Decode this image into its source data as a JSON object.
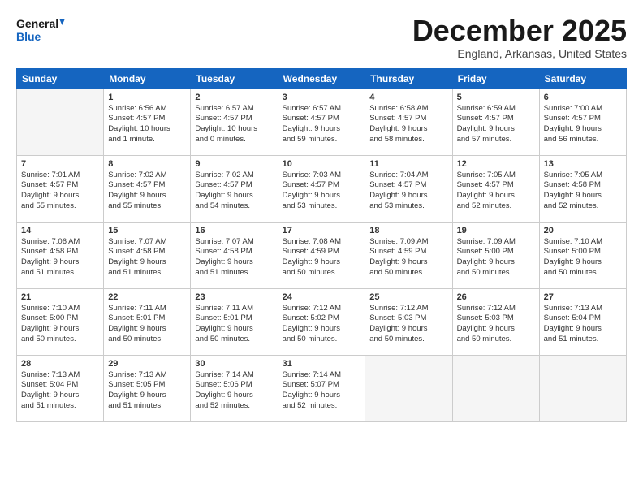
{
  "logo": {
    "line1": "General",
    "line2": "Blue"
  },
  "title": "December 2025",
  "subtitle": "England, Arkansas, United States",
  "days_header": [
    "Sunday",
    "Monday",
    "Tuesday",
    "Wednesday",
    "Thursday",
    "Friday",
    "Saturday"
  ],
  "weeks": [
    [
      {
        "day": "",
        "lines": []
      },
      {
        "day": "1",
        "lines": [
          "Sunrise: 6:56 AM",
          "Sunset: 4:57 PM",
          "Daylight: 10 hours",
          "and 1 minute."
        ]
      },
      {
        "day": "2",
        "lines": [
          "Sunrise: 6:57 AM",
          "Sunset: 4:57 PM",
          "Daylight: 10 hours",
          "and 0 minutes."
        ]
      },
      {
        "day": "3",
        "lines": [
          "Sunrise: 6:57 AM",
          "Sunset: 4:57 PM",
          "Daylight: 9 hours",
          "and 59 minutes."
        ]
      },
      {
        "day": "4",
        "lines": [
          "Sunrise: 6:58 AM",
          "Sunset: 4:57 PM",
          "Daylight: 9 hours",
          "and 58 minutes."
        ]
      },
      {
        "day": "5",
        "lines": [
          "Sunrise: 6:59 AM",
          "Sunset: 4:57 PM",
          "Daylight: 9 hours",
          "and 57 minutes."
        ]
      },
      {
        "day": "6",
        "lines": [
          "Sunrise: 7:00 AM",
          "Sunset: 4:57 PM",
          "Daylight: 9 hours",
          "and 56 minutes."
        ]
      }
    ],
    [
      {
        "day": "7",
        "lines": [
          "Sunrise: 7:01 AM",
          "Sunset: 4:57 PM",
          "Daylight: 9 hours",
          "and 55 minutes."
        ]
      },
      {
        "day": "8",
        "lines": [
          "Sunrise: 7:02 AM",
          "Sunset: 4:57 PM",
          "Daylight: 9 hours",
          "and 55 minutes."
        ]
      },
      {
        "day": "9",
        "lines": [
          "Sunrise: 7:02 AM",
          "Sunset: 4:57 PM",
          "Daylight: 9 hours",
          "and 54 minutes."
        ]
      },
      {
        "day": "10",
        "lines": [
          "Sunrise: 7:03 AM",
          "Sunset: 4:57 PM",
          "Daylight: 9 hours",
          "and 53 minutes."
        ]
      },
      {
        "day": "11",
        "lines": [
          "Sunrise: 7:04 AM",
          "Sunset: 4:57 PM",
          "Daylight: 9 hours",
          "and 53 minutes."
        ]
      },
      {
        "day": "12",
        "lines": [
          "Sunrise: 7:05 AM",
          "Sunset: 4:57 PM",
          "Daylight: 9 hours",
          "and 52 minutes."
        ]
      },
      {
        "day": "13",
        "lines": [
          "Sunrise: 7:05 AM",
          "Sunset: 4:58 PM",
          "Daylight: 9 hours",
          "and 52 minutes."
        ]
      }
    ],
    [
      {
        "day": "14",
        "lines": [
          "Sunrise: 7:06 AM",
          "Sunset: 4:58 PM",
          "Daylight: 9 hours",
          "and 51 minutes."
        ]
      },
      {
        "day": "15",
        "lines": [
          "Sunrise: 7:07 AM",
          "Sunset: 4:58 PM",
          "Daylight: 9 hours",
          "and 51 minutes."
        ]
      },
      {
        "day": "16",
        "lines": [
          "Sunrise: 7:07 AM",
          "Sunset: 4:58 PM",
          "Daylight: 9 hours",
          "and 51 minutes."
        ]
      },
      {
        "day": "17",
        "lines": [
          "Sunrise: 7:08 AM",
          "Sunset: 4:59 PM",
          "Daylight: 9 hours",
          "and 50 minutes."
        ]
      },
      {
        "day": "18",
        "lines": [
          "Sunrise: 7:09 AM",
          "Sunset: 4:59 PM",
          "Daylight: 9 hours",
          "and 50 minutes."
        ]
      },
      {
        "day": "19",
        "lines": [
          "Sunrise: 7:09 AM",
          "Sunset: 5:00 PM",
          "Daylight: 9 hours",
          "and 50 minutes."
        ]
      },
      {
        "day": "20",
        "lines": [
          "Sunrise: 7:10 AM",
          "Sunset: 5:00 PM",
          "Daylight: 9 hours",
          "and 50 minutes."
        ]
      }
    ],
    [
      {
        "day": "21",
        "lines": [
          "Sunrise: 7:10 AM",
          "Sunset: 5:00 PM",
          "Daylight: 9 hours",
          "and 50 minutes."
        ]
      },
      {
        "day": "22",
        "lines": [
          "Sunrise: 7:11 AM",
          "Sunset: 5:01 PM",
          "Daylight: 9 hours",
          "and 50 minutes."
        ]
      },
      {
        "day": "23",
        "lines": [
          "Sunrise: 7:11 AM",
          "Sunset: 5:01 PM",
          "Daylight: 9 hours",
          "and 50 minutes."
        ]
      },
      {
        "day": "24",
        "lines": [
          "Sunrise: 7:12 AM",
          "Sunset: 5:02 PM",
          "Daylight: 9 hours",
          "and 50 minutes."
        ]
      },
      {
        "day": "25",
        "lines": [
          "Sunrise: 7:12 AM",
          "Sunset: 5:03 PM",
          "Daylight: 9 hours",
          "and 50 minutes."
        ]
      },
      {
        "day": "26",
        "lines": [
          "Sunrise: 7:12 AM",
          "Sunset: 5:03 PM",
          "Daylight: 9 hours",
          "and 50 minutes."
        ]
      },
      {
        "day": "27",
        "lines": [
          "Sunrise: 7:13 AM",
          "Sunset: 5:04 PM",
          "Daylight: 9 hours",
          "and 51 minutes."
        ]
      }
    ],
    [
      {
        "day": "28",
        "lines": [
          "Sunrise: 7:13 AM",
          "Sunset: 5:04 PM",
          "Daylight: 9 hours",
          "and 51 minutes."
        ]
      },
      {
        "day": "29",
        "lines": [
          "Sunrise: 7:13 AM",
          "Sunset: 5:05 PM",
          "Daylight: 9 hours",
          "and 51 minutes."
        ]
      },
      {
        "day": "30",
        "lines": [
          "Sunrise: 7:14 AM",
          "Sunset: 5:06 PM",
          "Daylight: 9 hours",
          "and 52 minutes."
        ]
      },
      {
        "day": "31",
        "lines": [
          "Sunrise: 7:14 AM",
          "Sunset: 5:07 PM",
          "Daylight: 9 hours",
          "and 52 minutes."
        ]
      },
      {
        "day": "",
        "lines": []
      },
      {
        "day": "",
        "lines": []
      },
      {
        "day": "",
        "lines": []
      }
    ]
  ]
}
